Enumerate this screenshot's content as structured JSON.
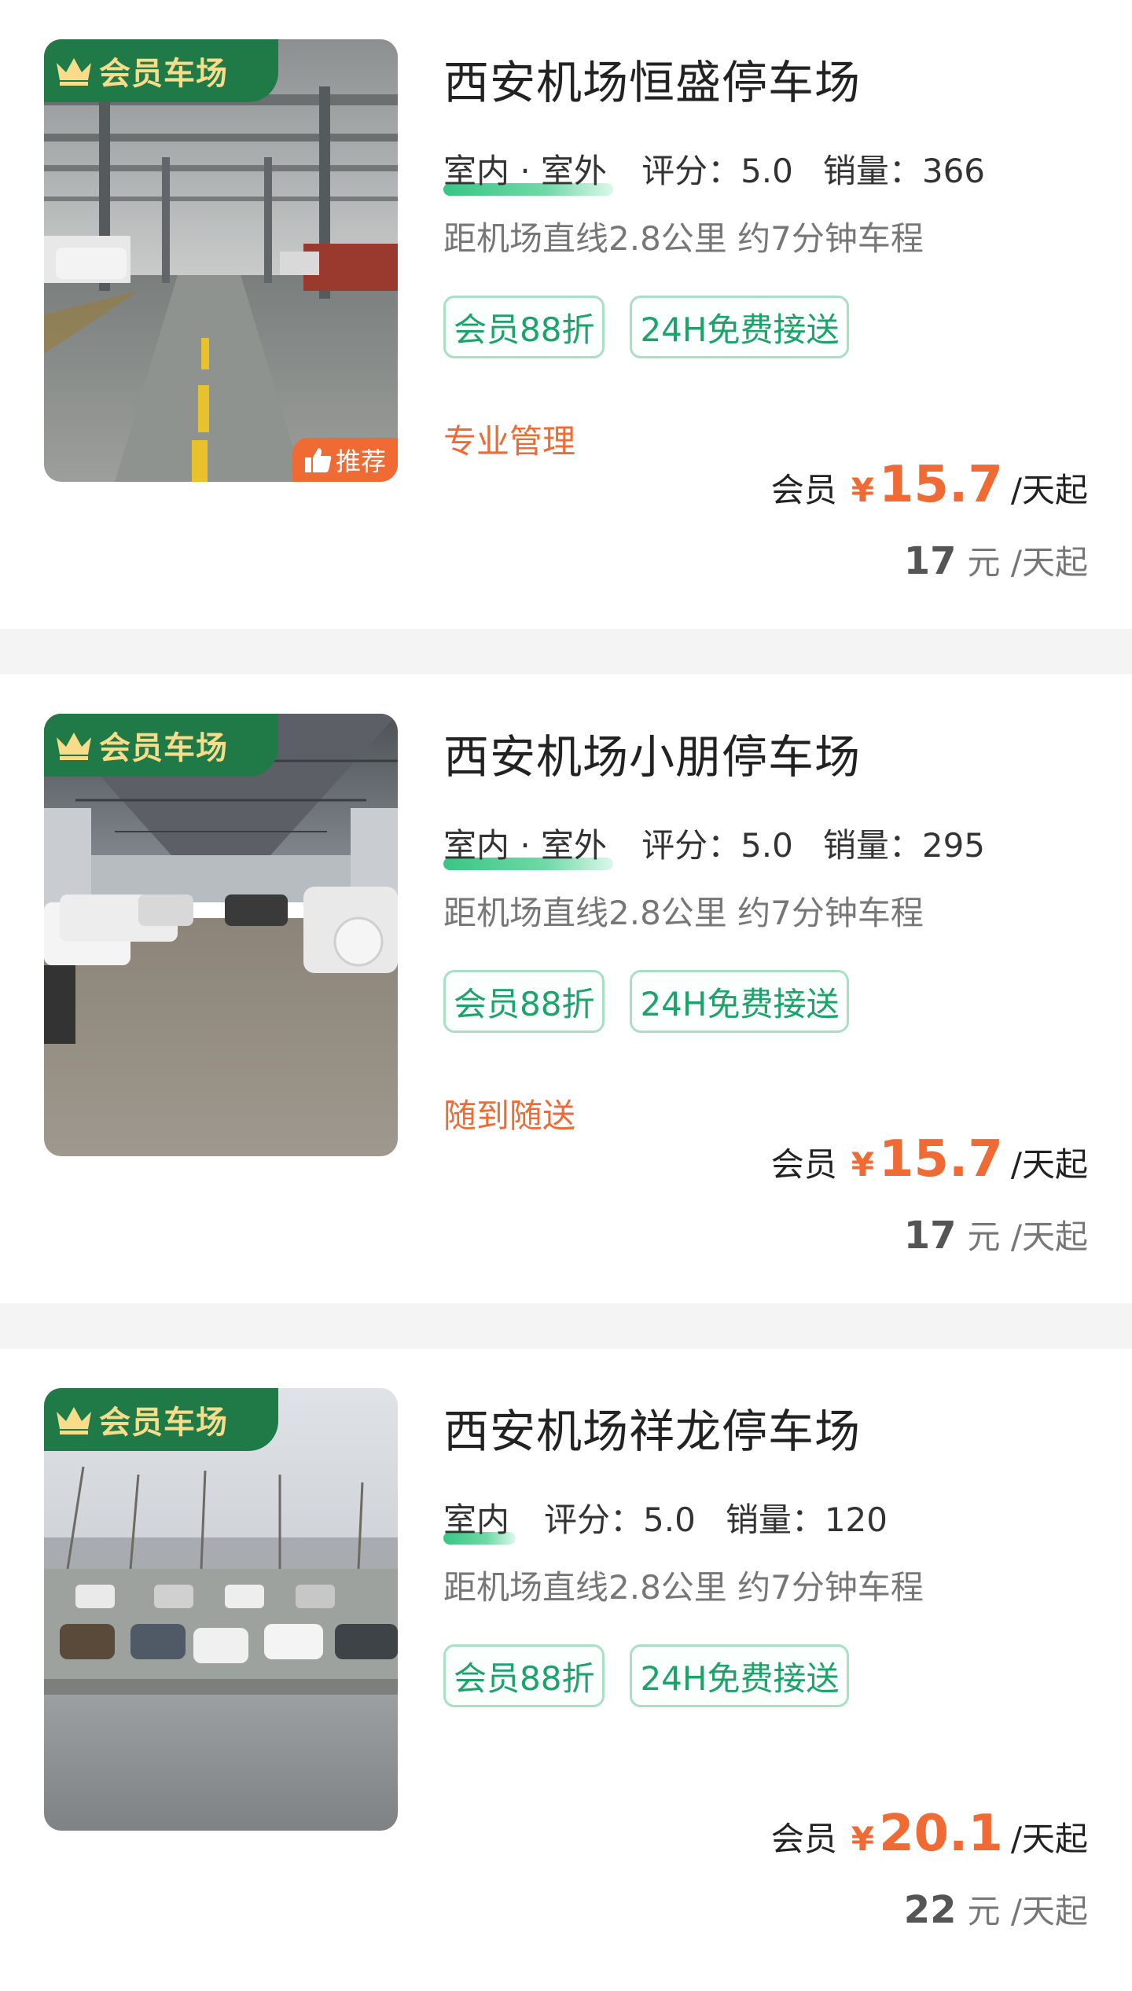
{
  "colors": {
    "accent": "#f06a34",
    "green": "#1ba36a",
    "badge_green": "#1f7a47",
    "badge_gold": "#f8dc8a"
  },
  "listings": [
    {
      "vip_badge": "会员车场",
      "recommend_badge": "推荐",
      "name": "西安机场恒盛停车场",
      "type": "室内 · 室外",
      "rating": "评分：5.0",
      "sales": "销量：366",
      "distance": "距机场直线2.8公里 约7分钟车程",
      "tags": [
        "会员88折",
        "24H免费接送"
      ],
      "feature": "专业管理",
      "member_label": "会员",
      "currency": "¥",
      "member_price": "15.7",
      "unit": "/天起",
      "orig_price": "17",
      "orig_unit": "元 /天起",
      "image": "indoor-garage-icon"
    },
    {
      "vip_badge": "会员车场",
      "recommend_badge": "",
      "name": "西安机场小朋停车场",
      "type": "室内 · 室外",
      "rating": "评分：5.0",
      "sales": "销量：295",
      "distance": "距机场直线2.8公里 约7分钟车程",
      "tags": [
        "会员88折",
        "24H免费接送"
      ],
      "feature": "随到随送",
      "member_label": "会员",
      "currency": "¥",
      "member_price": "15.7",
      "unit": "/天起",
      "orig_price": "17",
      "orig_unit": "元 /天起",
      "image": "covered-shed-icon"
    },
    {
      "vip_badge": "会员车场",
      "recommend_badge": "",
      "name": "西安机场祥龙停车场",
      "type": "室内",
      "rating": "评分：5.0",
      "sales": "销量：120",
      "distance": "距机场直线2.8公里 约7分钟车程",
      "tags": [
        "会员88折",
        "24H免费接送"
      ],
      "feature": "",
      "member_label": "会员",
      "currency": "¥",
      "member_price": "20.1",
      "unit": "/天起",
      "orig_price": "22",
      "orig_unit": "元 /天起",
      "image": "outdoor-lot-icon"
    }
  ]
}
